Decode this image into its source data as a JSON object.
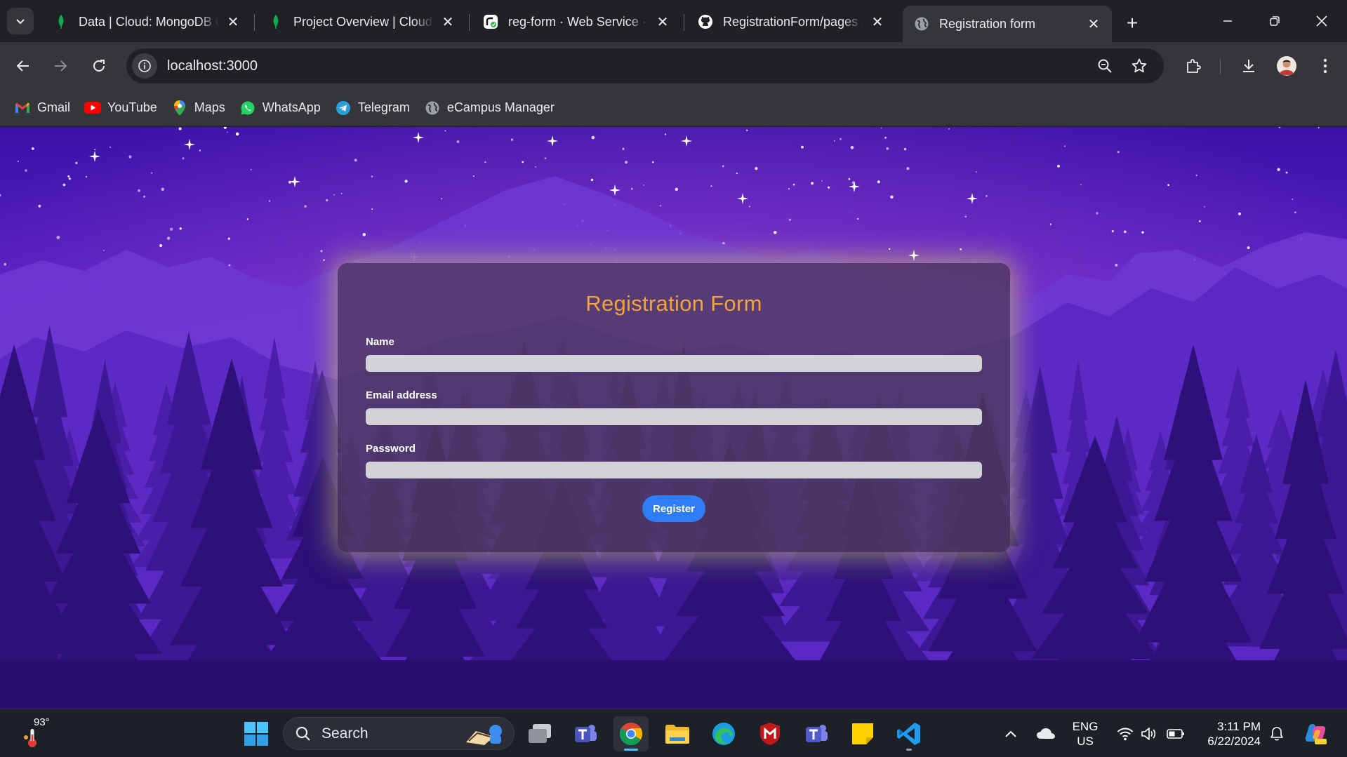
{
  "tabs": [
    {
      "title": "Data | Cloud: MongoDB Cloud",
      "icon": "mongodb-leaf-icon"
    },
    {
      "title": "Project Overview | Cloud: MongoDB",
      "icon": "mongodb-leaf-icon"
    },
    {
      "title": "reg-form · Web Service · Render",
      "icon": "render-icon"
    },
    {
      "title": "RegistrationForm/pages at main",
      "icon": "github-icon"
    },
    {
      "title": "Registration form",
      "icon": "globe-icon"
    }
  ],
  "address_bar": {
    "url": "localhost:3000"
  },
  "bookmarks": [
    {
      "label": "Gmail",
      "icon": "gmail-icon"
    },
    {
      "label": "YouTube",
      "icon": "youtube-icon"
    },
    {
      "label": "Maps",
      "icon": "maps-icon"
    },
    {
      "label": "WhatsApp",
      "icon": "whatsapp-icon"
    },
    {
      "label": "Telegram",
      "icon": "telegram-icon"
    },
    {
      "label": "eCampus Manager",
      "icon": "globe-icon"
    }
  ],
  "form": {
    "title": "Registration Form",
    "name_label": "Name",
    "email_label": "Email address",
    "password_label": "Password",
    "name_value": "",
    "email_value": "",
    "password_value": "",
    "register_label": "Register"
  },
  "colors": {
    "form_title": "#f2a33a",
    "register_button": "#2f7df5",
    "card_glow": "#dce65a",
    "sky_top": "#3b12a8",
    "sky_horizon": "#8a3bd6"
  },
  "taskbar": {
    "weather_temp": "93°",
    "search_label": "Search",
    "language_primary": "ENG",
    "language_secondary": "US",
    "time": "3:11 PM",
    "date": "6/22/2024"
  }
}
